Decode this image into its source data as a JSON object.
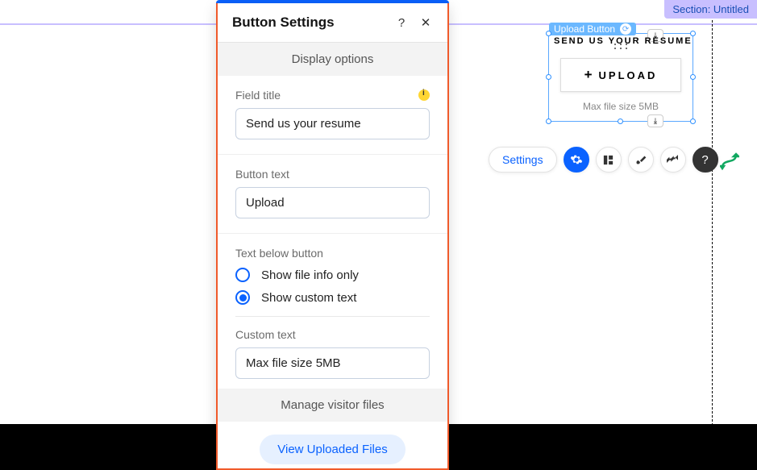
{
  "section_tag": "Section: Untitled",
  "panel": {
    "title": "Button Settings",
    "sections": {
      "display_options": "Display options",
      "manage_files": "Manage visitor files"
    },
    "field_title": {
      "label": "Field title",
      "value": "Send us your resume"
    },
    "button_text": {
      "label": "Button text",
      "value": "Upload"
    },
    "text_below": {
      "label": "Text below button",
      "options": [
        "Show file info only",
        "Show custom text"
      ],
      "selected_index": 1
    },
    "custom_text": {
      "label": "Custom text",
      "value": "Max file size 5MB"
    },
    "view_files_btn": "View Uploaded Files"
  },
  "widget": {
    "tag": "Upload Button",
    "title": "SEND US YOUR RESUME",
    "button": "UPLOAD",
    "subtext": "Max file size 5MB"
  },
  "toolbar": {
    "settings": "Settings"
  }
}
